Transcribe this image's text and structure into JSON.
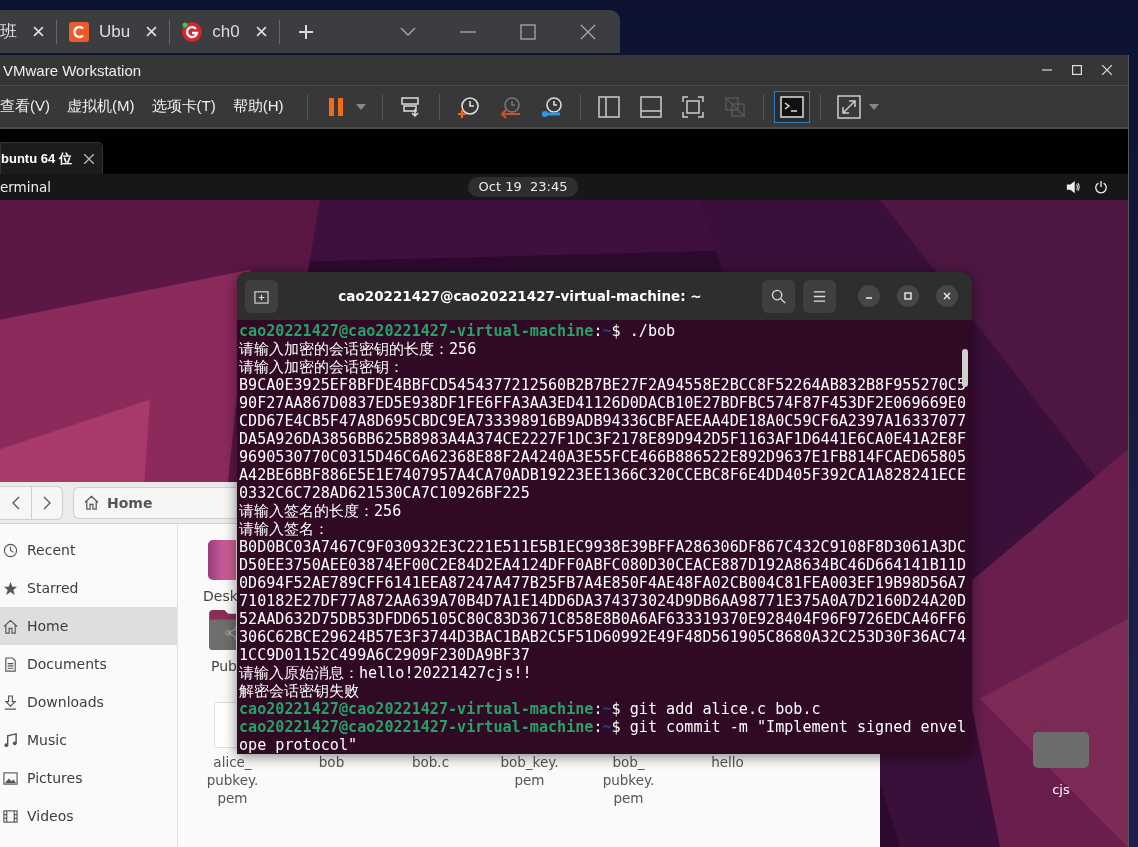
{
  "browser": {
    "tabs": [
      {
        "title": "班"
      },
      {
        "title": "Ubu"
      },
      {
        "title": "ch0"
      }
    ]
  },
  "window": {
    "title": "VMware Workstation"
  },
  "menus": [
    "查看(V)",
    "虚拟机(M)",
    "选项卡(T)",
    "帮助(H)"
  ],
  "toolbar_groups": [
    [
      {
        "kind": "pause",
        "dropdown": true,
        "selected": false
      }
    ],
    [
      {
        "kind": "send-keys",
        "dropdown": false,
        "selected": false
      }
    ],
    [
      {
        "kind": "snapshot-take",
        "dropdown": false,
        "selected": false
      },
      {
        "kind": "snapshot-revert",
        "dropdown": false,
        "selected": false
      },
      {
        "kind": "snapshot-manage",
        "dropdown": false,
        "selected": false
      }
    ],
    [
      {
        "kind": "view-sidebar",
        "dropdown": false,
        "selected": false
      },
      {
        "kind": "view-thumbnails",
        "dropdown": false,
        "selected": false
      },
      {
        "kind": "view-fit",
        "dropdown": false,
        "selected": false
      },
      {
        "kind": "view-unity",
        "dropdown": false,
        "selected": false
      }
    ],
    [
      {
        "kind": "console",
        "dropdown": false,
        "selected": true
      }
    ],
    [
      {
        "kind": "fullscreen",
        "dropdown": true,
        "selected": false
      }
    ]
  ],
  "vm_tab": {
    "title": "buntu 64 位"
  },
  "ubuntu_bar": {
    "app": "erminal",
    "clock": "Oct 19  23:45"
  },
  "terminal": {
    "title": "cao20221427@cao20221427-virtual-machine: ~",
    "lines": [
      {
        "kind": "prompt",
        "user": "cao20221427@cao20221427-virtual-machine",
        "colon": ":",
        "path": "~",
        "command": "$ ./bob"
      },
      {
        "kind": "output",
        "text": "请输入加密的会话密钥的长度：256"
      },
      {
        "kind": "output",
        "text": "请输入加密的会话密钥："
      },
      {
        "kind": "output",
        "text": "B9CA0E3925EF8BFDE4BBFCD5454377212560B2B7BE27F2A94558E2BCC8F52264AB832B8F955270C5"
      },
      {
        "kind": "output",
        "text": "90F27AA867D0837ED5E938DF1FE6FFA3AA3ED41126D0DACB10E27BDFBC574F87F453DF2E069669E0"
      },
      {
        "kind": "output",
        "text": "CDD67E4CB5F47A8D695CBDC9EA733398916B9ADB94336CBFAEEAA4DE18A0C59CF6A2397A16337077"
      },
      {
        "kind": "output",
        "text": "DA5A926DA3856BB625B8983A4A374CE2227F1DC3F2178E89D942D5F1163AF1D6441E6CA0E41A2E8F"
      },
      {
        "kind": "output",
        "text": "9690530770C0315D46C6A62368E88F2A4240A3E55FCE466B886522E892D9637E1FB814FCAED65805"
      },
      {
        "kind": "output",
        "text": "A42BE6BBF886E5E1E7407957A4CA70ADB19223EE1366C320CCEBC8F6E4DD405F392CA1A828241ECE"
      },
      {
        "kind": "output",
        "text": "0332C6C728AD621530CA7C10926BF225"
      },
      {
        "kind": "output",
        "text": "请输入签名的长度：256"
      },
      {
        "kind": "output",
        "text": "请输入签名："
      },
      {
        "kind": "output",
        "text": "B0D0BC03A7467C9F030932E3C221E511E5B1EC9938E39BFFA286306DF867C432C9108F8D3061A3DC"
      },
      {
        "kind": "output",
        "text": "D50EE3750AEE03874EF00C2E84D2EA4124DFF0ABFC080D30CEACE887D192A8634BC46D664141B11D"
      },
      {
        "kind": "output",
        "text": "0D694F52AE789CFF6141EEA87247A477B25FB7A4E850F4AE48FA02CB004C81FEA003EF19B98D56A7"
      },
      {
        "kind": "output",
        "text": "710182E27DF77A872AA639A70B4D7A1E14DD6DA374373024D9DB6AA98771E375A0A7D2160D24A20D"
      },
      {
        "kind": "output",
        "text": "52AAD632D75DB53DFDD65105C80C83D3671C858E8B0A6AF633319370E928404F96F9726EDCA46FF6"
      },
      {
        "kind": "output",
        "text": "306C62BCE29624B57E3F3744D3BAC1BAB2C5F51D60992E49F48D561905C8680A32C253D30F36AC74"
      },
      {
        "kind": "output",
        "text": "1CC9D01152C499A6C2909F230DA9BF37"
      },
      {
        "kind": "output",
        "text": "请输入原始消息：hello!20221427cjs!!"
      },
      {
        "kind": "output",
        "text": "解密会话密钥失败"
      },
      {
        "kind": "prompt",
        "user": "cao20221427@cao20221427-virtual-machine",
        "colon": ":",
        "path": "~",
        "command": "$ git add alice.c bob.c"
      },
      {
        "kind": "prompt",
        "user": "cao20221427@cao20221427-virtual-machine",
        "colon": ":",
        "path": "~",
        "command": "$ git commit -m \"Implement signed envel"
      },
      {
        "kind": "output",
        "text": "ope protocol\""
      }
    ]
  },
  "files": {
    "location": "Home",
    "sidebar": [
      {
        "label": "Recent",
        "selected": false
      },
      {
        "label": "Starred",
        "selected": false
      },
      {
        "label": "Home",
        "selected": true
      },
      {
        "label": "Documents",
        "selected": false
      },
      {
        "label": "Downloads",
        "selected": false
      },
      {
        "label": "Music",
        "selected": false
      },
      {
        "label": "Pictures",
        "selected": false
      },
      {
        "label": "Videos",
        "selected": false
      }
    ],
    "items": [
      {
        "name": "Desk",
        "kind": "desktop-folder"
      },
      {
        "name": "Pub",
        "kind": "shared-folder"
      },
      {
        "name": "alice_pubkey.pem",
        "kind": "file"
      },
      {
        "name": "bob",
        "kind": "covered"
      },
      {
        "name": "bob.c",
        "kind": "covered"
      },
      {
        "name": "bob_key.pem",
        "kind": "covered"
      },
      {
        "name": "bob_pubkey.pem",
        "kind": "covered"
      },
      {
        "name": "hello",
        "kind": "covered"
      }
    ]
  },
  "desktop_icons": [
    {
      "name": "cjs"
    }
  ]
}
